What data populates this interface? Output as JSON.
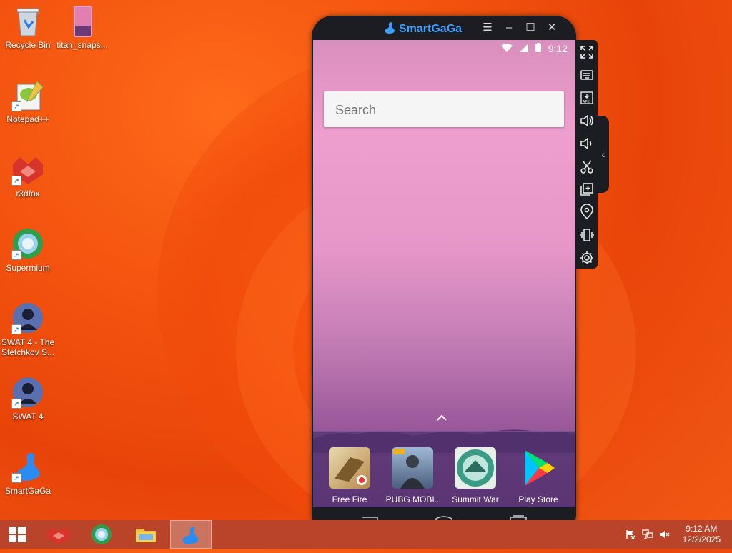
{
  "desktop": {
    "icons": [
      {
        "label": "Recycle Bin"
      },
      {
        "label": "titan_snaps..."
      },
      {
        "label": "Notepad++"
      },
      {
        "label": "r3dfox"
      },
      {
        "label": "Supermium"
      },
      {
        "label": "SWAT 4 - The Stetchkov S..."
      },
      {
        "label": "SWAT 4"
      },
      {
        "label": "SmartGaGa"
      }
    ]
  },
  "emulator": {
    "title": "SmartGaGa",
    "status": {
      "time": "9:12"
    },
    "search": {
      "placeholder": "Search"
    },
    "dock_apps": [
      {
        "label": "Free Fire"
      },
      {
        "label": "PUBG MOBI.."
      },
      {
        "label": "Summit War"
      },
      {
        "label": "Play Store"
      }
    ],
    "toolbar": [
      "fullscreen-icon",
      "keyboard-icon",
      "apk-install-icon",
      "volume-up-icon",
      "volume-down-icon",
      "screenshot-icon",
      "multi-instance-icon",
      "location-icon",
      "shake-icon",
      "settings-icon"
    ]
  },
  "taskbar": {
    "time": "9:12 AM",
    "date": "12/2/2025"
  },
  "colors": {
    "accent": "#3aa0ff",
    "taskbar": "#b9442a"
  }
}
